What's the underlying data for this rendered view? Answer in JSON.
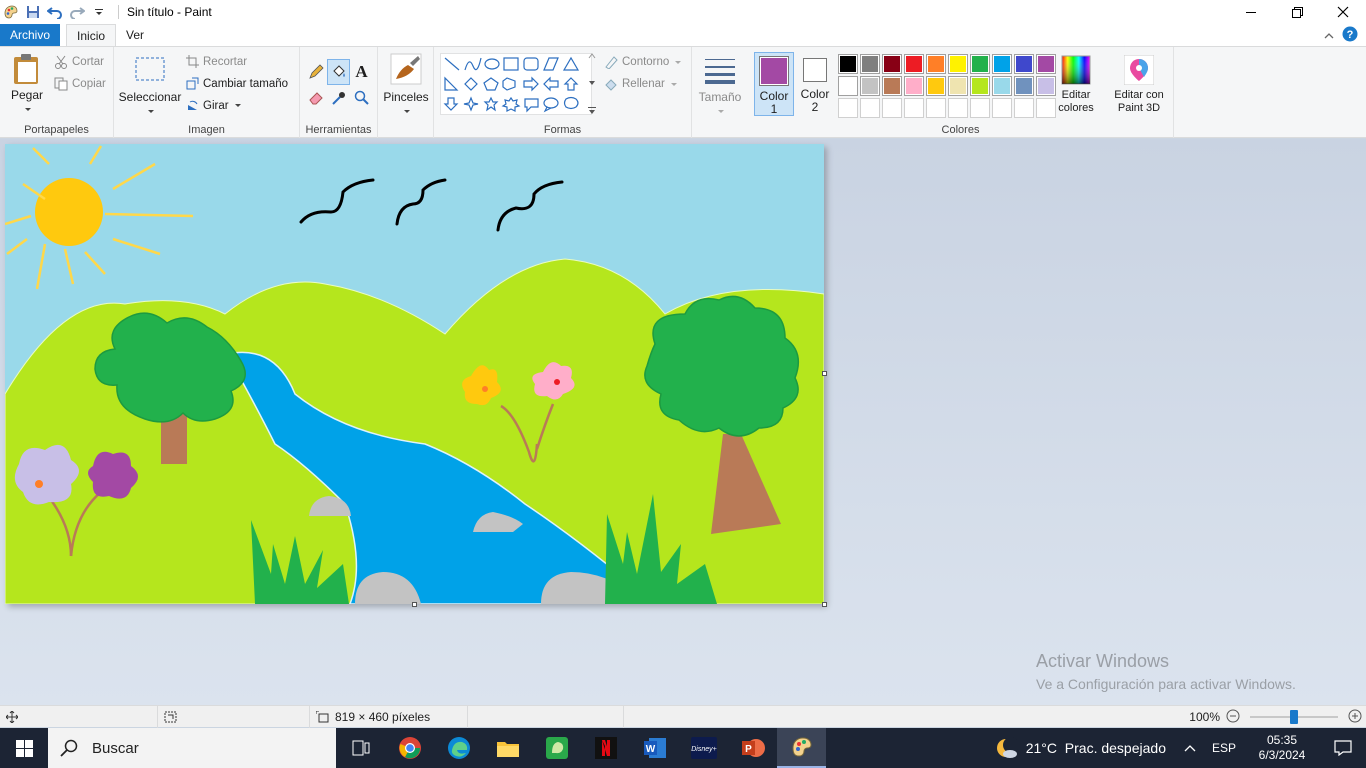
{
  "window": {
    "title": "Sin título - Paint"
  },
  "tabs": [
    {
      "label": "Archivo"
    },
    {
      "label": "Inicio"
    },
    {
      "label": "Ver"
    }
  ],
  "ribbon": {
    "clipboard": {
      "label": "Portapapeles",
      "paste": "Pegar",
      "cut": "Cortar",
      "copy": "Copiar"
    },
    "image": {
      "label": "Imagen",
      "select": "Seleccionar",
      "crop": "Recortar",
      "resize": "Cambiar tamaño",
      "rotate": "Girar"
    },
    "tools": {
      "label": "Herramientas"
    },
    "brushes": {
      "label": "Pinceles"
    },
    "shapes": {
      "label": "Formas",
      "outline": "Contorno",
      "fill": "Rellenar"
    },
    "size": {
      "label": "Tamaño"
    },
    "color1": {
      "label": "Color",
      "label2": "1",
      "value": "#a349a4"
    },
    "color2": {
      "label": "Color",
      "label2": "2",
      "value": "#ffffff"
    },
    "colors": {
      "label": "Colores",
      "edit_label": "Editar",
      "edit_label2": "colores",
      "palette_row1": [
        "#000000",
        "#7f7f7f",
        "#880015",
        "#ed1c24",
        "#ff7f27",
        "#fff200",
        "#22b14c",
        "#00a2e8",
        "#3f48cc",
        "#a349a4"
      ],
      "palette_row2": [
        "#ffffff",
        "#c3c3c3",
        "#b97a57",
        "#ffaec9",
        "#ffc90e",
        "#efe4b0",
        "#b5e61d",
        "#99d9ea",
        "#7092be",
        "#c8bfe7"
      ]
    },
    "paint3d": {
      "label": "Editar con",
      "label2": "Paint 3D"
    }
  },
  "status": {
    "dimensions": "819 × 460 píxeles",
    "zoom": "100%",
    "zoom_level": 1.0
  },
  "watermark": {
    "line1": "Activar Windows",
    "line2": "Ve a Configuración para activar Windows."
  },
  "taskbar": {
    "search_placeholder": "Buscar",
    "weather": "21°C  Prac. despejado",
    "lang": "ESP",
    "time": "05:35",
    "date": "6/3/2024"
  }
}
